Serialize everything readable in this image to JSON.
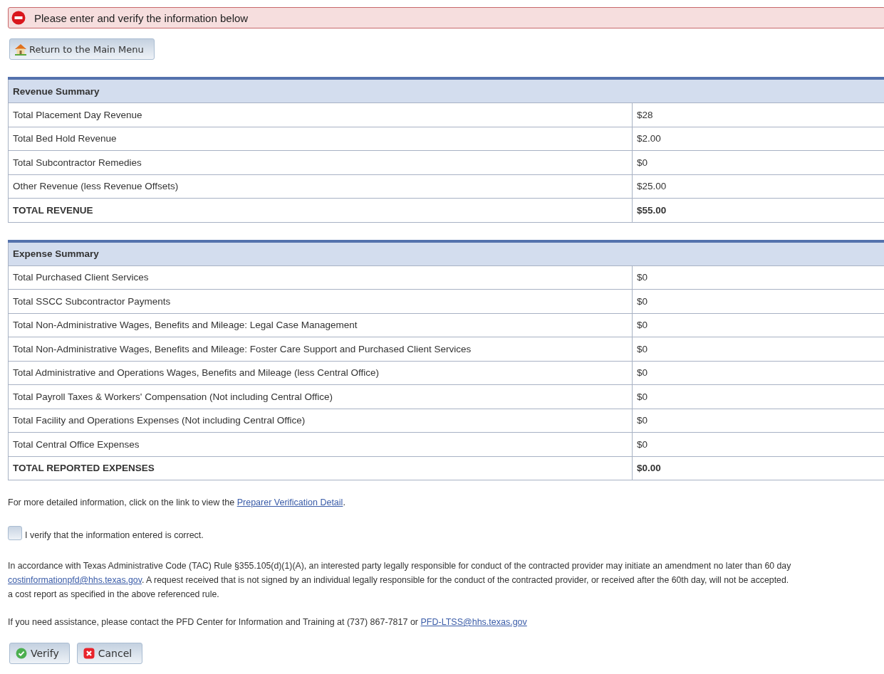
{
  "alert": {
    "kind": "error",
    "message": "Please enter and verify the information below"
  },
  "main_menu_button": {
    "label": "Return to the Main Menu"
  },
  "tables": [
    {
      "title": "Revenue Summary",
      "rows": [
        {
          "label": "Total Placement Day Revenue",
          "value": "$28",
          "total": false
        },
        {
          "label": "Total Bed Hold Revenue",
          "value": "$2.00",
          "total": false
        },
        {
          "label": "Total Subcontractor Remedies",
          "value": "$0",
          "total": false
        },
        {
          "label": "Other Revenue (less Revenue Offsets)",
          "value": "$25.00",
          "total": false
        },
        {
          "label": "TOTAL REVENUE",
          "value": "$55.00",
          "total": true
        }
      ]
    },
    {
      "title": "Expense Summary",
      "rows": [
        {
          "label": "Total Purchased Client Services",
          "value": "$0",
          "total": false
        },
        {
          "label": "Total SSCC Subcontractor Payments",
          "value": "$0",
          "total": false
        },
        {
          "label": "Total Non-Administrative Wages, Benefits and Mileage: Legal Case Management",
          "value": "$0",
          "total": false
        },
        {
          "label": "Total Non-Administrative Wages, Benefits and Mileage: Foster Care Support and Purchased Client Services",
          "value": "$0",
          "total": false
        },
        {
          "label": "Total Administrative and Operations Wages, Benefits and Mileage (less Central Office)",
          "value": "$0",
          "total": false
        },
        {
          "label": "Total Payroll Taxes & Workers' Compensation (Not including Central Office)",
          "value": "$0",
          "total": false
        },
        {
          "label": "Total Facility and Operations Expenses (Not including Central Office)",
          "value": "$0",
          "total": false
        },
        {
          "label": "Total Central Office Expenses",
          "value": "$0",
          "total": false
        },
        {
          "label": "TOTAL REPORTED EXPENSES",
          "value": "$0.00",
          "total": true
        }
      ]
    }
  ],
  "detail_note": {
    "text": "For more detailed information, click on the link to view the ",
    "link": "Preparer Verification Detail",
    "after": "."
  },
  "verify_checkbox": {
    "label": "I verify that the information entered is correct.",
    "checked": false
  },
  "rule_text": {
    "line_1": "In accordance with Texas Administrative Code (TAC) Rule §355.105(d)(1)(A), an interested party legally responsible for conduct of the contracted provider may initiate an amendment no later than 60 day",
    "email": "costinformationpfd@hhs.texas.gov",
    "line_2": ". A request received that is not signed by an individual legally responsible for the conduct of the contracted provider, or received after the 60th day, will not be accepted.",
    "line_3": "a cost report as specified in the above referenced rule."
  },
  "assistance": {
    "text": "If you need assistance, please contact the PFD Center for Information and Training at (737) 867-7817 or ",
    "email": "PFD-LTSS@hhs.texas.gov"
  },
  "buttons": [
    {
      "kind": "verify",
      "label": "Verify"
    },
    {
      "kind": "cancel",
      "label": "Cancel"
    }
  ]
}
